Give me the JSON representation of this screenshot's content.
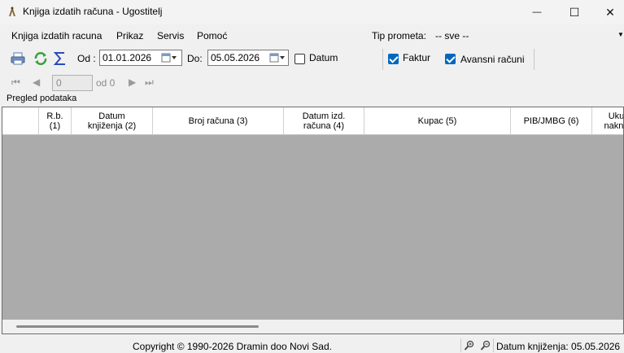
{
  "window": {
    "title": "Knjiga izdatih računa - Ugostitelj",
    "minimize_glyph": "—",
    "maximize_glyph": "☐",
    "close_glyph": "✕"
  },
  "menu": {
    "items": [
      "Knjiga izdatih racuna",
      "Prikaz",
      "Servis",
      "Pomoć"
    ],
    "tip_prometa_label": "Tip prometa:",
    "tip_prometa_value": "-- sve --"
  },
  "toolbar": {
    "od_label": "Od :",
    "od_value": "01.01.2026",
    "do_label": "Do:",
    "do_value": "05.05.2026",
    "datum_label": "Datum",
    "datum_checked": false,
    "faktur_label": "Faktur",
    "faktur_checked": true,
    "avansni_label": "Avansni računi",
    "avansni_checked": true
  },
  "navigator": {
    "position": "0",
    "count_text": "od 0"
  },
  "grid": {
    "section_label": "Pregled podataka",
    "columns": [
      "",
      "R.b.\n(1)",
      "Datum\nknjiženja (2)",
      "Broj računa (3)",
      "Datum izd.\nračuna (4)",
      "Kupac (5)",
      "PIB/JMBG (6)",
      "Uku\nnakna"
    ],
    "rows": []
  },
  "status": {
    "copyright": "Copyright © 1990-2026 Dramin doo Novi Sad.",
    "datum_knjizenja": "Datum knjiženja: 05.05.2026"
  },
  "colors": {
    "grid_background": "#ababab",
    "checkbox_accent": "#0067c0"
  }
}
